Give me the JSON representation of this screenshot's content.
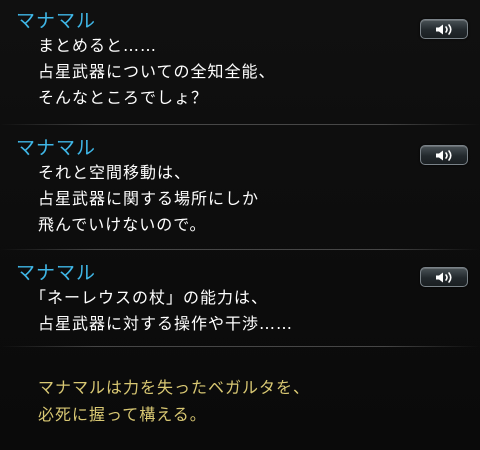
{
  "log": {
    "entries": [
      {
        "speaker": "マナマル",
        "lines": [
          "まとめると……",
          "占星武器についての全知全能、",
          "そんなところでしょ？"
        ],
        "voice_icon": "speaker-icon"
      },
      {
        "speaker": "マナマル",
        "lines": [
          "それと空間移動は、",
          "占星武器に関する場所にしか",
          "飛んでいけないので。"
        ],
        "voice_icon": "speaker-icon"
      },
      {
        "speaker": "マナマル",
        "lines": [
          "「ネーレウスの杖」の能力は、",
          "占星武器に対する操作や干渉……"
        ],
        "voice_icon": "speaker-icon"
      }
    ],
    "narration": {
      "lines": [
        "マナマルは力を失ったベガルタを、",
        "必死に握って構える。"
      ]
    }
  },
  "colors": {
    "speaker": "#3fb6e6",
    "dialogue": "#ffffff",
    "narration": "#d9c873",
    "background": "#0c0c0c"
  }
}
